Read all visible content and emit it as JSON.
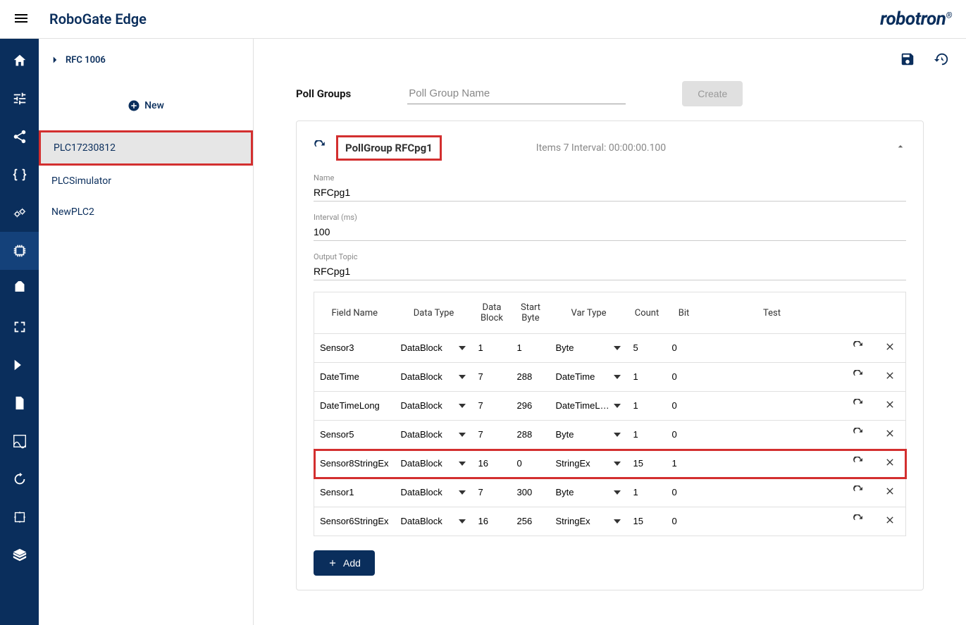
{
  "app_title": "RoboGate Edge",
  "brand": "robotron",
  "breadcrumb": "RFC 1006",
  "panel": {
    "new_label": "New",
    "items": [
      {
        "label": "PLC17230812",
        "selected": true,
        "highlight": true
      },
      {
        "label": "PLCSimulator",
        "selected": false,
        "highlight": false
      },
      {
        "label": "NewPLC2",
        "selected": false,
        "highlight": false
      }
    ]
  },
  "pollgroups": {
    "title": "Poll Groups",
    "name_placeholder": "Poll Group Name",
    "create_label": "Create",
    "card": {
      "header_title": "PollGroup RFCpg1",
      "meta": "Items 7  Interval: 00:00:00.100",
      "fields": {
        "name_label": "Name",
        "name_value": "RFCpg1",
        "interval_label": "Interval (ms)",
        "interval_value": "100",
        "output_label": "Output Topic",
        "output_value": "RFCpg1"
      },
      "columns": [
        "Field Name",
        "Data Type",
        "Data Block",
        "Start Byte",
        "Var Type",
        "Count",
        "Bit",
        "Test"
      ],
      "rows": [
        {
          "field": "Sensor3",
          "dtype": "DataBlock",
          "block": "1",
          "start": "1",
          "var": "Byte",
          "count": "5",
          "bit": "0",
          "hl": false
        },
        {
          "field": "DateTime",
          "dtype": "DataBlock",
          "block": "7",
          "start": "288",
          "var": "DateTime",
          "count": "1",
          "bit": "0",
          "hl": false
        },
        {
          "field": "DateTimeLong",
          "dtype": "DataBlock",
          "block": "7",
          "start": "296",
          "var": "DateTimeLong",
          "count": "1",
          "bit": "0",
          "hl": false
        },
        {
          "field": "Sensor5",
          "dtype": "DataBlock",
          "block": "7",
          "start": "288",
          "var": "Byte",
          "count": "1",
          "bit": "0",
          "hl": false
        },
        {
          "field": "Sensor8StringEx",
          "dtype": "DataBlock",
          "block": "16",
          "start": "0",
          "var": "StringEx",
          "count": "15",
          "bit": "1",
          "hl": true
        },
        {
          "field": "Sensor1",
          "dtype": "DataBlock",
          "block": "7",
          "start": "300",
          "var": "Byte",
          "count": "1",
          "bit": "0",
          "hl": false
        },
        {
          "field": "Sensor6StringEx",
          "dtype": "DataBlock",
          "block": "16",
          "start": "256",
          "var": "StringEx",
          "count": "15",
          "bit": "0",
          "hl": false
        }
      ],
      "add_label": "Add"
    }
  }
}
